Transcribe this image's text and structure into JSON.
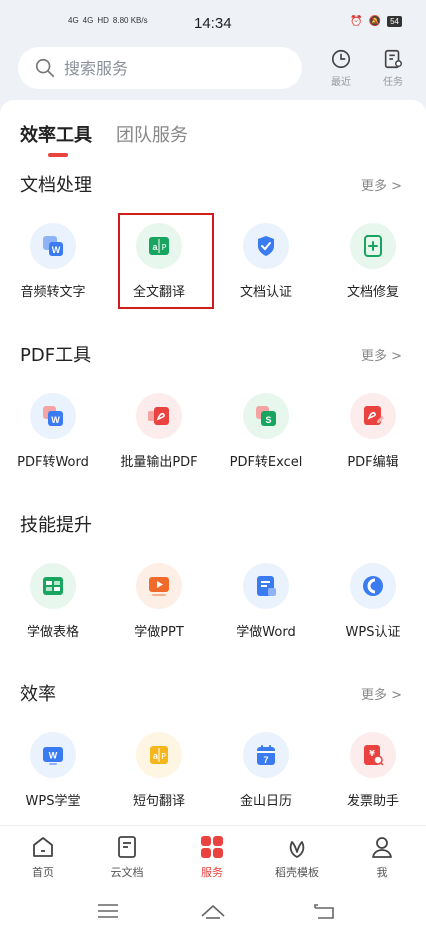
{
  "status_bar": {
    "net1": "4G",
    "net2": "4G",
    "hd": "HD",
    "speed": "8.80 KB/s",
    "time": "14:34",
    "battery": "54"
  },
  "header": {
    "search_placeholder": "搜索服务",
    "recent_label": "最近",
    "task_label": "任务"
  },
  "tabs": [
    {
      "label": "效率工具",
      "active": true
    },
    {
      "label": "团队服务",
      "active": false
    }
  ],
  "sections": [
    {
      "title": "文档处理",
      "more": "更多 >",
      "items": [
        {
          "label": "音频转文字",
          "icon": "audio-to-text-icon"
        },
        {
          "label": "全文翻译",
          "icon": "full-translate-icon"
        },
        {
          "label": "文档认证",
          "icon": "doc-certify-icon"
        },
        {
          "label": "文档修复",
          "icon": "doc-repair-icon"
        }
      ]
    },
    {
      "title": "PDF工具",
      "more": "更多 >",
      "items": [
        {
          "label": "PDF转Word",
          "icon": "pdf-to-word-icon"
        },
        {
          "label": "批量输出PDF",
          "icon": "batch-pdf-icon"
        },
        {
          "label": "PDF转Excel",
          "icon": "pdf-to-excel-icon"
        },
        {
          "label": "PDF编辑",
          "icon": "pdf-edit-icon"
        }
      ]
    },
    {
      "title": "技能提升",
      "more": "",
      "items": [
        {
          "label": "学做表格",
          "icon": "learn-sheet-icon"
        },
        {
          "label": "学做PPT",
          "icon": "learn-ppt-icon"
        },
        {
          "label": "学做Word",
          "icon": "learn-word-icon"
        },
        {
          "label": "WPS认证",
          "icon": "wps-certify-icon"
        }
      ]
    },
    {
      "title": "效率",
      "more": "更多 >",
      "items": [
        {
          "label": "WPS学堂",
          "icon": "wps-school-icon"
        },
        {
          "label": "短句翻译",
          "icon": "phrase-translate-icon"
        },
        {
          "label": "金山日历",
          "icon": "calendar-icon"
        },
        {
          "label": "发票助手",
          "icon": "invoice-icon"
        }
      ]
    }
  ],
  "bottom_nav": [
    {
      "label": "首页",
      "icon": "home-icon",
      "active": false
    },
    {
      "label": "云文档",
      "icon": "cloud-doc-icon",
      "active": false
    },
    {
      "label": "服务",
      "icon": "services-icon",
      "active": true
    },
    {
      "label": "稻壳模板",
      "icon": "template-icon",
      "active": false
    },
    {
      "label": "我",
      "icon": "profile-icon",
      "active": false
    }
  ],
  "colors": {
    "accent": "#e9423f",
    "blue": "#3a7bf2",
    "green": "#19a55f",
    "orange": "#f06a2b"
  }
}
